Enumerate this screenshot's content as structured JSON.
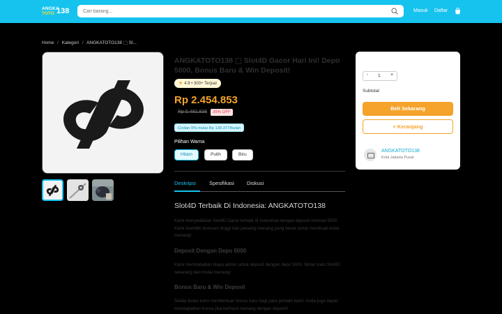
{
  "header": {
    "logo_line1": "ANGKA",
    "logo_line2": "TOTO",
    "logo_num": "138",
    "search_placeholder": "Cari barang...",
    "login_label": "Masuk",
    "register_label": "Daftar",
    "icons": {
      "search": "search-icon",
      "cart": "cart-icon"
    }
  },
  "breadcrumb": {
    "items": [
      "Home",
      "Kategori",
      "ANGKATOTO138 ⬚ Sl..."
    ],
    "separator": "/"
  },
  "product": {
    "title": "ANGKATOTO138 ⬚ Slot4D Gacor Hari Ini! Depo 5000, Bonus Baru & Win Deposit!",
    "rating_text": "4.9 • 300+ Terjual",
    "price": "Rp 2.454.853",
    "old_price": "Rp 5.481.838",
    "discount": "35% OFF",
    "installment": "Cicilan 0% mulai Rp 139.377/bulan",
    "variant_label": "Pilihan Warna",
    "variants": [
      "Hitam",
      "Putih",
      "Biru"
    ],
    "selected_variant": "Hitam"
  },
  "tabs": [
    "Deskripsi",
    "Spesifikasi",
    "Diskusi"
  ],
  "description": {
    "heading": "Slot4D Terbaik Di Indonesia: ANGKATOTO138",
    "p1": "Kami menyediakan Slot4D Gacor terbaik di Indonesia dengan deposit minimal 5000. Kami memiliki bonuses tinggi dan peluang menang yang besar untuk membuat Anda menang!",
    "sub1": "Deposit Dengan Depo 5000",
    "p2": "Kami membatalkan biaya admin untuk deposit dengan depo 5000. Mulai main Slot4D sekarang dan mulai menang!",
    "sub2": "Bonus Baru & Win Deposit",
    "p3": "Setiap bulan kami memberikan bonus baru bagi para pemain kami. Anda juga dapat mendapatkan bonus jika berhasil menang dengan deposit!"
  },
  "purchase": {
    "minus": "-",
    "qty": "1",
    "plus": "+",
    "subtotal_label": "Subtotal",
    "buy_label": "Beli Sekarang",
    "cart_label": "+ Keranjang",
    "seller_name": "ANGKATOTO138",
    "seller_location": "Kota Jakarta Pusat"
  },
  "colors": {
    "header_bg": "#16c3ee",
    "accent_orange": "#f5a32a",
    "accent_cyan": "#16c3ee"
  }
}
